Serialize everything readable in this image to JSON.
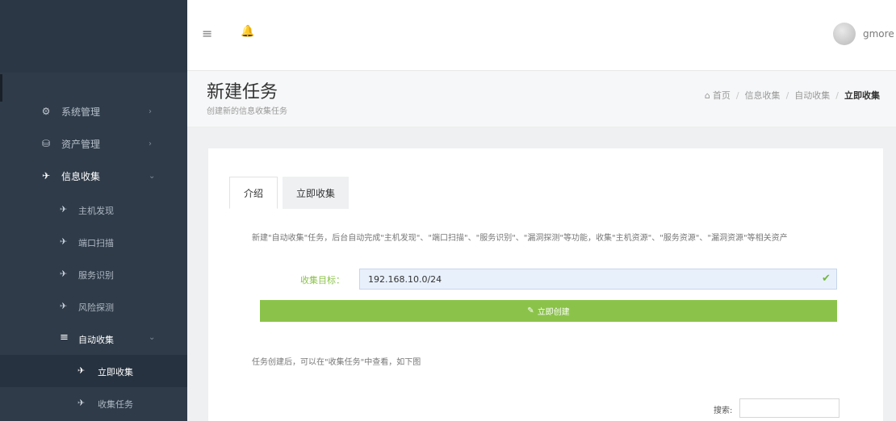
{
  "sidebar": {
    "items": [
      {
        "label": "系统管理",
        "icon": "gear-icon",
        "glyph": "⚙",
        "chevron": "›"
      },
      {
        "label": "资产管理",
        "icon": "database-icon",
        "glyph": "⛁",
        "chevron": "›"
      },
      {
        "label": "信息收集",
        "icon": "rocket-icon",
        "glyph": "✈",
        "chevron": "⌄"
      }
    ],
    "sub_items": [
      {
        "label": "主机发现",
        "glyph": "✈"
      },
      {
        "label": "端口扫描",
        "glyph": "✈"
      },
      {
        "label": "服务识别",
        "glyph": "✈"
      },
      {
        "label": "风险探测",
        "glyph": "✈"
      },
      {
        "label": "自动收集",
        "glyph": "≡",
        "chevron": "⌄"
      }
    ],
    "subsub_items": [
      {
        "label": "立即收集",
        "glyph": "✈"
      },
      {
        "label": "收集任务",
        "glyph": "✈"
      }
    ]
  },
  "topbar": {
    "menu_glyph": "≡",
    "bell_glyph": "🔔",
    "username": "gmore ⌄"
  },
  "header": {
    "title": "新建任务",
    "subtitle": "创建新的信息收集任务",
    "breadcrumb": {
      "home_glyph": "⌂",
      "home": "首页",
      "separator": "/",
      "level1": "信息收集",
      "level2": "自动收集",
      "current": "立即收集"
    }
  },
  "tabs": [
    {
      "label": "介绍",
      "active": true
    },
    {
      "label": "立即收集",
      "active": false
    }
  ],
  "intro": {
    "description": "新建\"自动收集\"任务，后台自动完成\"主机发现\"、\"端口扫描\"、\"服务识别\"、\"漏洞探测\"等功能，收集\"主机资源\"、\"服务资源\"、\"漏洞资源\"等相关资产",
    "form_label": "收集目标：",
    "target_value": "192.168.10.0/24",
    "check_glyph": "✔",
    "button_glyph": "✎",
    "button_label": "立即创建",
    "note": "任务创建后，可以在\"收集任务\"中查看，如下图",
    "search_label": "搜索:"
  },
  "colors": {
    "sidebar_bg": "#2f3b49",
    "accent_green": "#8bc34a",
    "input_bg": "#e8f0fc"
  }
}
